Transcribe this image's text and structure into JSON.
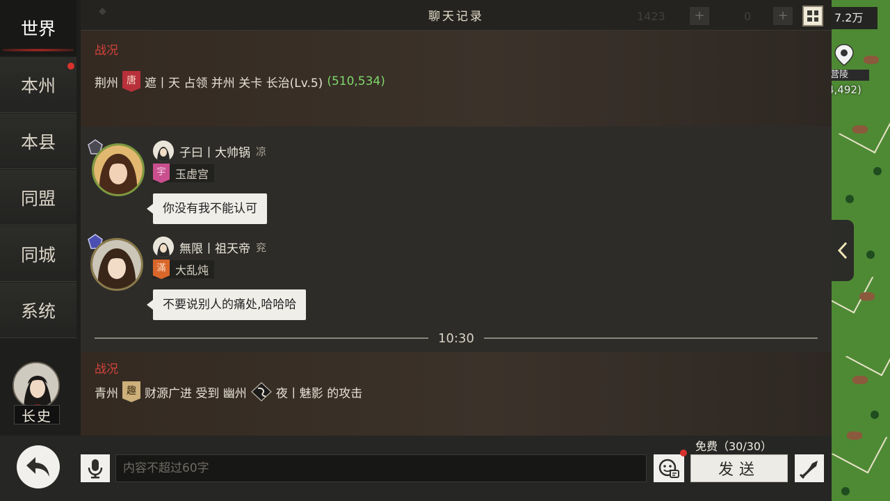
{
  "header": {
    "title": "聊天记录",
    "resource_value": "7.2万",
    "ghost_counts": [
      "1423",
      "0"
    ]
  },
  "sidebar": {
    "items": [
      {
        "label": "世界",
        "active": true
      },
      {
        "label": "本州",
        "badge": true
      },
      {
        "label": "本县"
      },
      {
        "label": "同盟"
      },
      {
        "label": "同城"
      },
      {
        "label": "系统"
      }
    ],
    "player_title": "长史"
  },
  "chat": {
    "report1": {
      "title": "战况",
      "region": "荆州",
      "flag_char": "唐",
      "text": "遮丨天 占领 并州 关卡 长治(Lv.5)",
      "coords": "(510,534)"
    },
    "messages": [
      {
        "name": "子曰丨大帅锅",
        "region": "凉",
        "guild_flag": "宇",
        "guild": "玉虚宫",
        "text": "你没有我不能认可"
      },
      {
        "name": "無限丨祖天帝",
        "region": "兖",
        "guild_flag": "滿",
        "guild": "大乱炖",
        "text": "不要说别人的痛处,哈哈哈"
      }
    ],
    "divider_time": "10:30",
    "report2": {
      "title": "战况",
      "region": "青州",
      "flag_char": "趣",
      "text_a": "财源广进 受到 幽州",
      "text_b": "夜丨魅影 的攻击"
    }
  },
  "input": {
    "placeholder": "内容不超过60字",
    "value": "",
    "send_label": "发送",
    "free_label": "免费（30/30）"
  },
  "map": {
    "pin_label": "营陵",
    "pin_coords": "4,492)"
  },
  "colors": {
    "accent_red": "#d3433a",
    "coords_green": "#7ed86a",
    "map_green": "#4e8a34"
  }
}
